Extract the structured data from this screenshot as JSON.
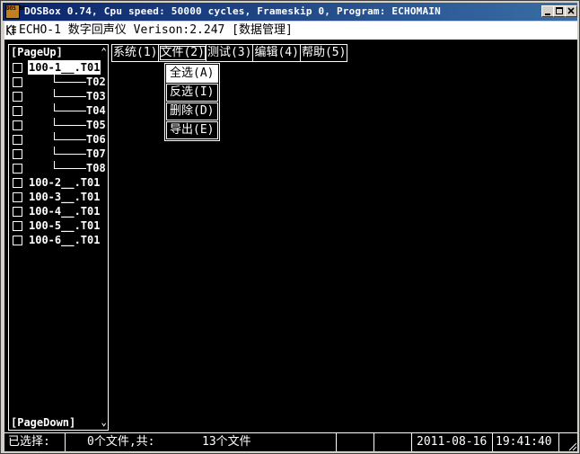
{
  "window": {
    "title": "DOSBox 0.74, Cpu speed:    50000 cycles, Frameskip  0, Program: ECHOMAIN",
    "icon_text": "DOS BOX",
    "controls": [
      "minimize-icon",
      "maximize-icon",
      "close-icon"
    ]
  },
  "app": {
    "header": "ECHO-1 数字回声仪 Verison:2.247 [数据管理]"
  },
  "file_panel": {
    "page_up": "[PageUp]",
    "page_down": "[PageDown]",
    "items": [
      {
        "label": "100-1__.T01",
        "level": 0,
        "selected": true,
        "checked": false
      },
      {
        "label": "T02",
        "level": 1,
        "selected": false,
        "checked": false
      },
      {
        "label": "T03",
        "level": 1,
        "selected": false,
        "checked": false
      },
      {
        "label": "T04",
        "level": 1,
        "selected": false,
        "checked": false
      },
      {
        "label": "T05",
        "level": 1,
        "selected": false,
        "checked": false
      },
      {
        "label": "T06",
        "level": 1,
        "selected": false,
        "checked": false
      },
      {
        "label": "T07",
        "level": 1,
        "selected": false,
        "checked": false
      },
      {
        "label": "T08",
        "level": 1,
        "selected": false,
        "checked": false
      },
      {
        "label": "100-2__.T01",
        "level": 0,
        "selected": false,
        "checked": false
      },
      {
        "label": "100-3__.T01",
        "level": 0,
        "selected": false,
        "checked": false
      },
      {
        "label": "100-4__.T01",
        "level": 0,
        "selected": false,
        "checked": false
      },
      {
        "label": "100-5__.T01",
        "level": 0,
        "selected": false,
        "checked": false
      },
      {
        "label": "100-6__.T01",
        "level": 0,
        "selected": false,
        "checked": false
      }
    ]
  },
  "menu": {
    "items": [
      "系统(1)",
      "文件(2)",
      "测试(3)",
      "编辑(4)",
      "帮助(5)"
    ],
    "active": 1
  },
  "dropdown": {
    "items": [
      "全选(A)",
      "反选(I)",
      "删除(D)",
      "导出(E)"
    ],
    "active": 0
  },
  "status": {
    "selected_label": "已选择:",
    "selected_count": "0个文件,共:",
    "total": "13个文件",
    "date": "2011-08-16",
    "time": "19:41:40"
  }
}
